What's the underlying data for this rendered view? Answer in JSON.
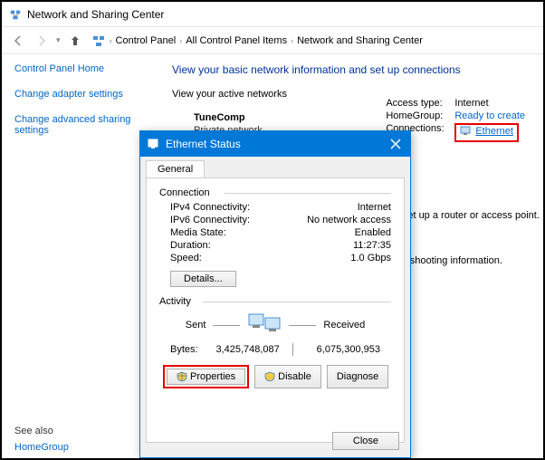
{
  "window": {
    "title": "Network and Sharing Center"
  },
  "breadcrumb": {
    "items": [
      "Control Panel",
      "All Control Panel Items",
      "Network and Sharing Center"
    ]
  },
  "sidebar": {
    "home": "Control Panel Home",
    "adapter": "Change adapter settings",
    "sharing": "Change advanced sharing settings",
    "seeAlso": "See also",
    "homegroup": "HomeGroup"
  },
  "main": {
    "heading": "View your basic network information and set up connections",
    "subheading": "View your active networks",
    "networkName": "TuneComp",
    "networkType": "Private network",
    "access": {
      "typeLabel": "Access type:",
      "typeValue": "Internet",
      "hgLabel": "HomeGroup:",
      "hgValue": "Ready to create",
      "connLabel": "Connections:",
      "connValue": "Ethernet"
    },
    "hint1": "or set up a router or access point.",
    "hint2": "ubleshooting information."
  },
  "dialog": {
    "title": "Ethernet Status",
    "tab": "General",
    "connectionLabel": "Connection",
    "rows": {
      "ipv4k": "IPv4 Connectivity:",
      "ipv4v": "Internet",
      "ipv6k": "IPv6 Connectivity:",
      "ipv6v": "No network access",
      "mediak": "Media State:",
      "mediav": "Enabled",
      "durk": "Duration:",
      "durv": "11:27:35",
      "speedk": "Speed:",
      "speedv": "1.0 Gbps"
    },
    "detailsBtn": "Details...",
    "activityLabel": "Activity",
    "sent": "Sent",
    "received": "Received",
    "bytesLabel": "Bytes:",
    "bytesSent": "3,425,748,087",
    "bytesRecv": "6,075,300,953",
    "propsBtn": "Properties",
    "disableBtn": "Disable",
    "diagnoseBtn": "Diagnose",
    "closeBtn": "Close"
  }
}
